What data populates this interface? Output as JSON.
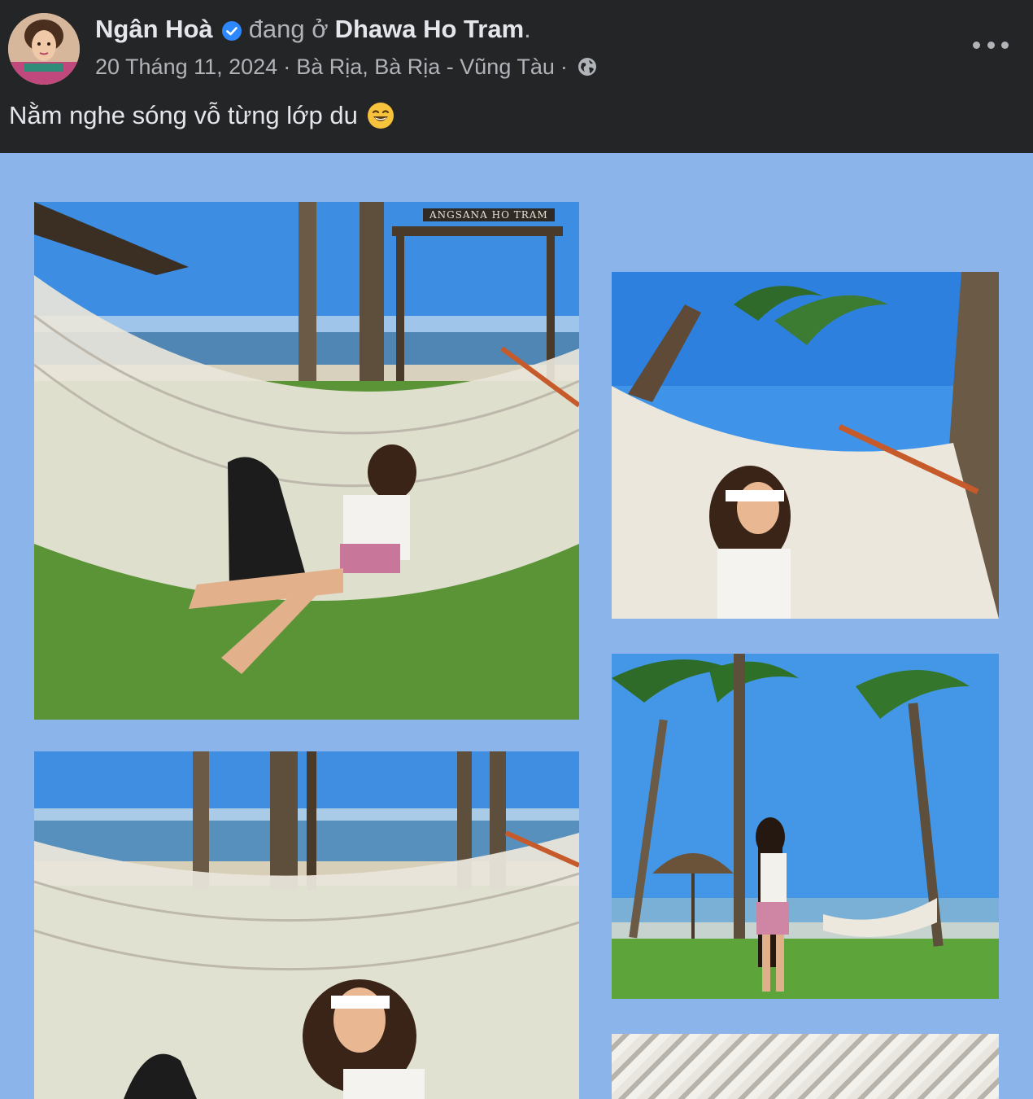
{
  "post": {
    "author": "Ngân Hoà",
    "at_text": "đang ở",
    "place": "Dhawa Ho Tram",
    "place_end": ".",
    "date": "20 Tháng 11, 2024",
    "separator": "·",
    "location": "Bà Rịa, Bà Rịa - Vũng Tàu",
    "caption": "Nằm nghe sóng vỗ từng lớp du",
    "icons": {
      "verified": "verified-badge-icon",
      "privacy": "globe-icon",
      "more": "more-options-icon",
      "emoji": "grinning-emoji-icon"
    }
  },
  "photos": [
    {
      "sign": "ANGSANA HO TRAM"
    }
  ],
  "colors": {
    "header_bg": "#242526",
    "page_bg": "#8ab4ea",
    "verified": "#2d88ff",
    "primary_text": "#e4e6eb",
    "secondary_text": "#b0b3b8"
  }
}
